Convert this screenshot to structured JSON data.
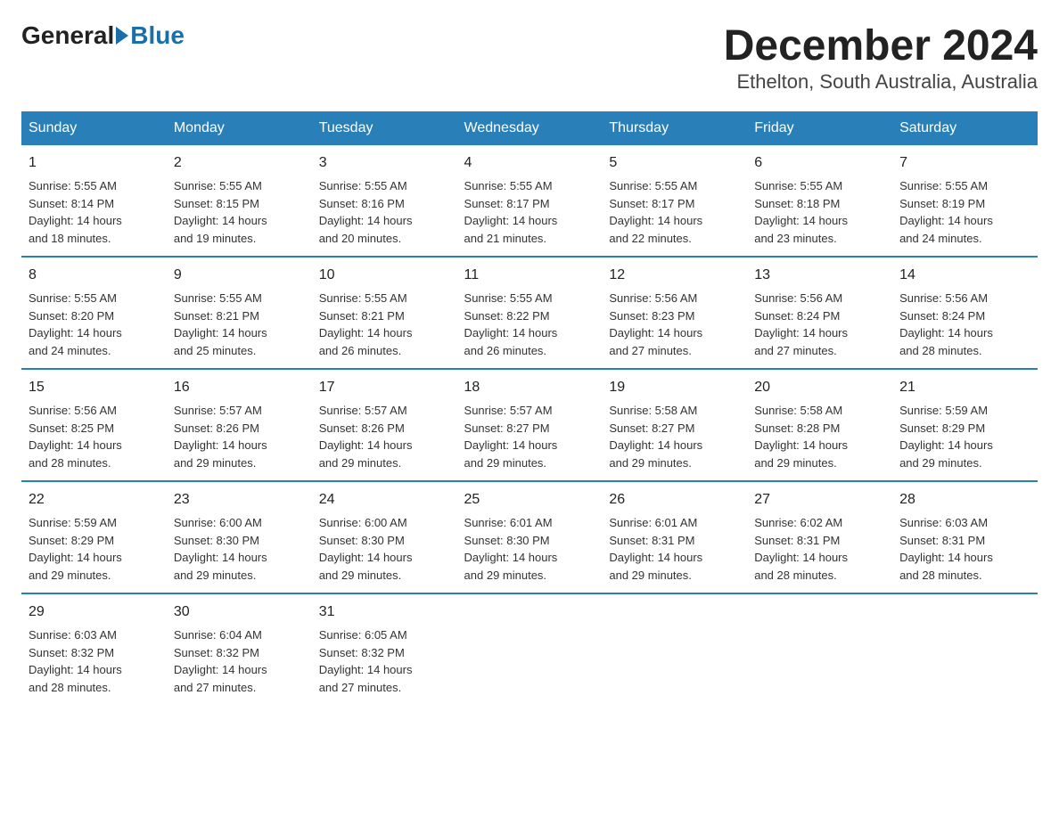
{
  "header": {
    "logo_general": "General",
    "logo_blue": "Blue",
    "month_year": "December 2024",
    "location": "Ethelton, South Australia, Australia"
  },
  "days_of_week": [
    "Sunday",
    "Monday",
    "Tuesday",
    "Wednesday",
    "Thursday",
    "Friday",
    "Saturday"
  ],
  "weeks": [
    [
      {
        "day": "1",
        "sunrise": "5:55 AM",
        "sunset": "8:14 PM",
        "daylight": "14 hours and 18 minutes."
      },
      {
        "day": "2",
        "sunrise": "5:55 AM",
        "sunset": "8:15 PM",
        "daylight": "14 hours and 19 minutes."
      },
      {
        "day": "3",
        "sunrise": "5:55 AM",
        "sunset": "8:16 PM",
        "daylight": "14 hours and 20 minutes."
      },
      {
        "day": "4",
        "sunrise": "5:55 AM",
        "sunset": "8:17 PM",
        "daylight": "14 hours and 21 minutes."
      },
      {
        "day": "5",
        "sunrise": "5:55 AM",
        "sunset": "8:17 PM",
        "daylight": "14 hours and 22 minutes."
      },
      {
        "day": "6",
        "sunrise": "5:55 AM",
        "sunset": "8:18 PM",
        "daylight": "14 hours and 23 minutes."
      },
      {
        "day": "7",
        "sunrise": "5:55 AM",
        "sunset": "8:19 PM",
        "daylight": "14 hours and 24 minutes."
      }
    ],
    [
      {
        "day": "8",
        "sunrise": "5:55 AM",
        "sunset": "8:20 PM",
        "daylight": "14 hours and 24 minutes."
      },
      {
        "day": "9",
        "sunrise": "5:55 AM",
        "sunset": "8:21 PM",
        "daylight": "14 hours and 25 minutes."
      },
      {
        "day": "10",
        "sunrise": "5:55 AM",
        "sunset": "8:21 PM",
        "daylight": "14 hours and 26 minutes."
      },
      {
        "day": "11",
        "sunrise": "5:55 AM",
        "sunset": "8:22 PM",
        "daylight": "14 hours and 26 minutes."
      },
      {
        "day": "12",
        "sunrise": "5:56 AM",
        "sunset": "8:23 PM",
        "daylight": "14 hours and 27 minutes."
      },
      {
        "day": "13",
        "sunrise": "5:56 AM",
        "sunset": "8:24 PM",
        "daylight": "14 hours and 27 minutes."
      },
      {
        "day": "14",
        "sunrise": "5:56 AM",
        "sunset": "8:24 PM",
        "daylight": "14 hours and 28 minutes."
      }
    ],
    [
      {
        "day": "15",
        "sunrise": "5:56 AM",
        "sunset": "8:25 PM",
        "daylight": "14 hours and 28 minutes."
      },
      {
        "day": "16",
        "sunrise": "5:57 AM",
        "sunset": "8:26 PM",
        "daylight": "14 hours and 29 minutes."
      },
      {
        "day": "17",
        "sunrise": "5:57 AM",
        "sunset": "8:26 PM",
        "daylight": "14 hours and 29 minutes."
      },
      {
        "day": "18",
        "sunrise": "5:57 AM",
        "sunset": "8:27 PM",
        "daylight": "14 hours and 29 minutes."
      },
      {
        "day": "19",
        "sunrise": "5:58 AM",
        "sunset": "8:27 PM",
        "daylight": "14 hours and 29 minutes."
      },
      {
        "day": "20",
        "sunrise": "5:58 AM",
        "sunset": "8:28 PM",
        "daylight": "14 hours and 29 minutes."
      },
      {
        "day": "21",
        "sunrise": "5:59 AM",
        "sunset": "8:29 PM",
        "daylight": "14 hours and 29 minutes."
      }
    ],
    [
      {
        "day": "22",
        "sunrise": "5:59 AM",
        "sunset": "8:29 PM",
        "daylight": "14 hours and 29 minutes."
      },
      {
        "day": "23",
        "sunrise": "6:00 AM",
        "sunset": "8:30 PM",
        "daylight": "14 hours and 29 minutes."
      },
      {
        "day": "24",
        "sunrise": "6:00 AM",
        "sunset": "8:30 PM",
        "daylight": "14 hours and 29 minutes."
      },
      {
        "day": "25",
        "sunrise": "6:01 AM",
        "sunset": "8:30 PM",
        "daylight": "14 hours and 29 minutes."
      },
      {
        "day": "26",
        "sunrise": "6:01 AM",
        "sunset": "8:31 PM",
        "daylight": "14 hours and 29 minutes."
      },
      {
        "day": "27",
        "sunrise": "6:02 AM",
        "sunset": "8:31 PM",
        "daylight": "14 hours and 28 minutes."
      },
      {
        "day": "28",
        "sunrise": "6:03 AM",
        "sunset": "8:31 PM",
        "daylight": "14 hours and 28 minutes."
      }
    ],
    [
      {
        "day": "29",
        "sunrise": "6:03 AM",
        "sunset": "8:32 PM",
        "daylight": "14 hours and 28 minutes."
      },
      {
        "day": "30",
        "sunrise": "6:04 AM",
        "sunset": "8:32 PM",
        "daylight": "14 hours and 27 minutes."
      },
      {
        "day": "31",
        "sunrise": "6:05 AM",
        "sunset": "8:32 PM",
        "daylight": "14 hours and 27 minutes."
      },
      null,
      null,
      null,
      null
    ]
  ],
  "labels": {
    "sunrise": "Sunrise:",
    "sunset": "Sunset:",
    "daylight": "Daylight:"
  }
}
